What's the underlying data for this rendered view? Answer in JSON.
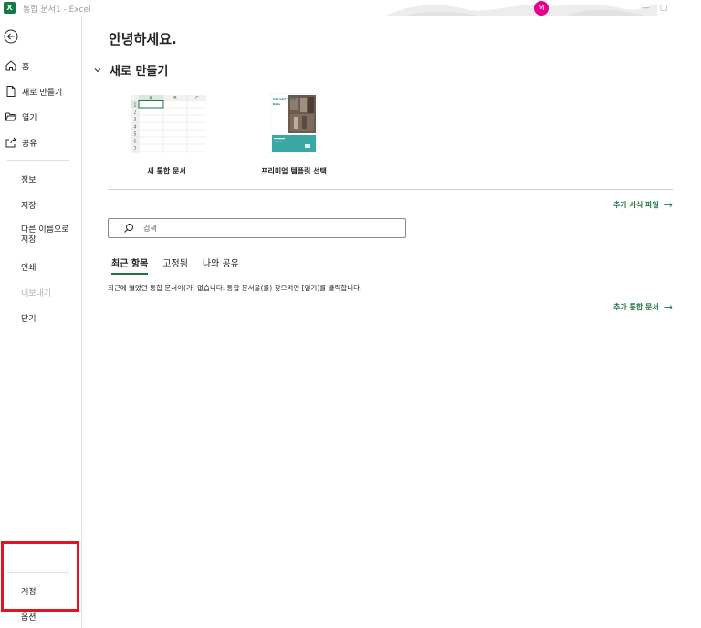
{
  "titlebar": {
    "app_icon_letter": "X",
    "title": "통합 문서1  -  Excel",
    "avatar_initial": "M",
    "minimize": "—",
    "restore": "▢"
  },
  "sidebar": {
    "items": [
      {
        "label": "홈",
        "icon": "home-icon"
      },
      {
        "label": "새로 만들기",
        "icon": "new-document-icon"
      },
      {
        "label": "열기",
        "icon": "folder-open-icon"
      },
      {
        "label": "공유",
        "icon": "share-icon"
      }
    ],
    "secondary": [
      {
        "label": "정보"
      },
      {
        "label": "저장"
      },
      {
        "label": "다른 이름으로\n저장"
      },
      {
        "label": "인쇄"
      },
      {
        "label": "내보내기",
        "disabled": true
      },
      {
        "label": "닫기"
      }
    ],
    "bottom": [
      {
        "label": "계정"
      },
      {
        "label": "옵션"
      }
    ]
  },
  "main": {
    "greeting": "안녕하세요.",
    "new_section_title": "새로 만들기",
    "templates": [
      {
        "label": "새 통합 문서"
      },
      {
        "label": "프리미엄 템플릿 선택"
      }
    ],
    "spreadsheet_thumb": {
      "columns": [
        "A",
        "B",
        "C"
      ],
      "rows": [
        "1",
        "2",
        "3",
        "4",
        "5",
        "6",
        "7"
      ]
    },
    "report_thumb": {
      "title": "REPORT TITLE",
      "subtitle": "Date"
    },
    "more_templates_link": "추가 서식 파일",
    "search_placeholder": "검색",
    "tabs": [
      {
        "label": "최근 항목",
        "active": true
      },
      {
        "label": "고정됨",
        "active": false
      },
      {
        "label": "나와 공유",
        "active": false
      }
    ],
    "empty_message": "최근에 열었던 통합 문서이(가) 없습니다. 통합 문서을(를) 찾으려면 [열기]를 클릭합니다.",
    "more_workbooks_link": "추가 통합 문서",
    "link_arrow": "→"
  },
  "colors": {
    "accent": "#217346",
    "excel_green": "#107c41",
    "avatar": "#e3008c",
    "highlight": "#e81123"
  }
}
